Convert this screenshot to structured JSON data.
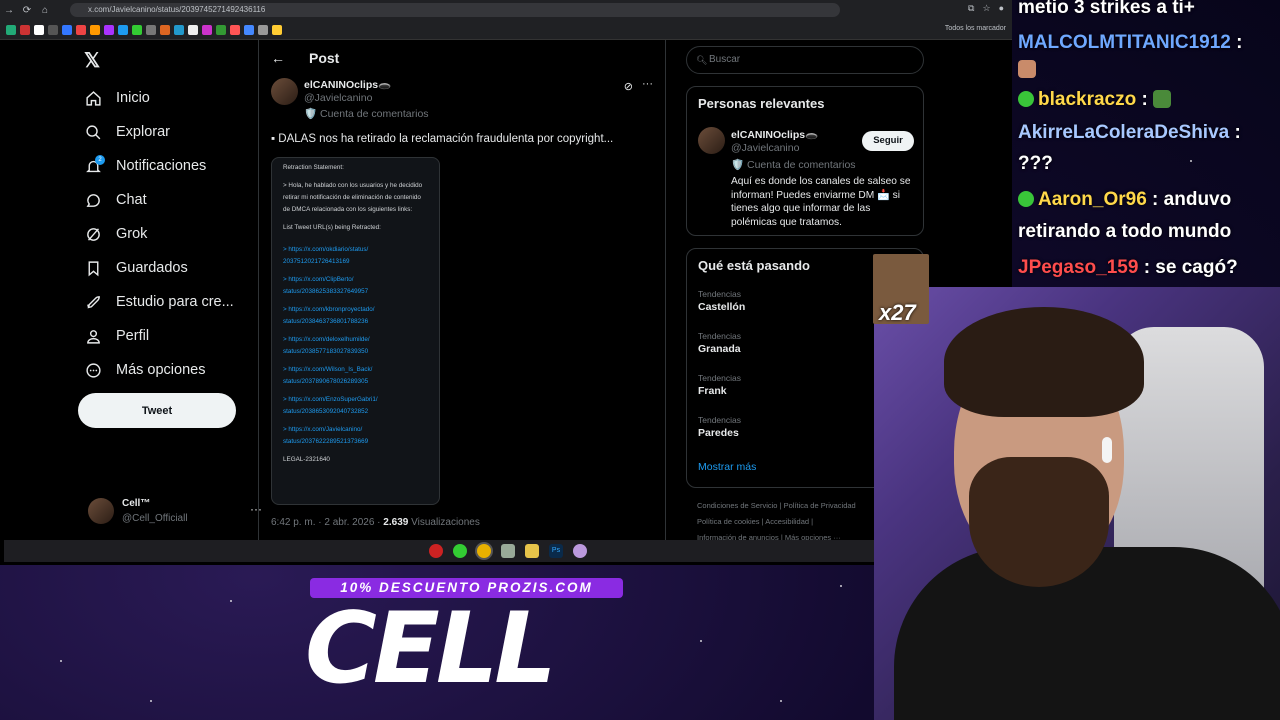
{
  "browser": {
    "url": "x.com/Javielcanino/status/2039745271492436116",
    "bookmark_folder": "Todos los marcador"
  },
  "nav": {
    "items": [
      {
        "label": "Inicio",
        "icon": "home-icon"
      },
      {
        "label": "Explorar",
        "icon": "search-icon"
      },
      {
        "label": "Notificaciones",
        "icon": "bell-icon"
      },
      {
        "label": "Chat",
        "icon": "chat-icon"
      },
      {
        "label": "Grok",
        "icon": "grok-icon"
      },
      {
        "label": "Guardados",
        "icon": "bookmark-icon"
      },
      {
        "label": "Estudio para cre...",
        "icon": "rocket-icon"
      },
      {
        "label": "Perfil",
        "icon": "person-icon"
      },
      {
        "label": "Más opciones",
        "icon": "more-circle-icon"
      }
    ],
    "notif_badge": "2",
    "tweet_button": "Tweet",
    "account": {
      "name": "Cell™",
      "handle": "@Cell_Officiall"
    }
  },
  "post": {
    "header": "Post",
    "author_name": "elCANINOclips🕳️",
    "author_handle": "@Javielcanino",
    "author_tag": "🛡️ Cuenta de comentarios",
    "text": "▪ DALAS nos ha retirado la reclamación fraudulenta por copyright...",
    "statement": {
      "title": "Retraction Statement:",
      "body": "> Hola, he hablado con los usuarios y he decidido retirar mi notificación de eliminación de contenido de DMCA relacionada con los siguientes links:",
      "list_title": "List Tweet URL(s) being Retracted:",
      "links": [
        "> https://x.com/okdiario/status/ 2037512021726413169",
        "> https://x.com/ClipBerto/ status/2038625383327649957",
        "> https://x.com/kbronproyectado/ status/2038463736801788236",
        "> https://x.com/deloxelhumilde/ status/2038577183027839350",
        "> https://x.com/Wilson_Is_Back/ status/2037890678026289305",
        "> https://x.com/EnzoSuperGabri1/ status/2038653092040732852",
        "> https://x.com/Javielcanino/ status/2037622289521373669"
      ],
      "legal": "LEGAL-2321640"
    },
    "time": "6:42 p. m. · 2 abr. 2026 · ",
    "views_count": "2.639",
    "views_label": " Visualizaciones"
  },
  "right": {
    "search_placeholder": "Buscar",
    "relevant_title": "Personas relevantes",
    "relevant_name": "elCANINOclips🕳️",
    "relevant_handle": "@Javielcanino",
    "relevant_tag": "🛡️ Cuenta de comentarios",
    "relevant_bio": "Aquí es donde los canales de salseo se informan! Puedes enviarme DM 📩 si tienes algo que informar de las polémicas que tratamos.",
    "follow_label": "Seguir",
    "trends_title": "Qué está pasando",
    "trends": [
      {
        "category": "Tendencias",
        "topic": "Castellón"
      },
      {
        "category": "Tendencias",
        "topic": "Granada"
      },
      {
        "category": "Tendencias",
        "topic": "Frank"
      },
      {
        "category": "Tendencias",
        "topic": "Paredes"
      }
    ],
    "show_more": "Mostrar más",
    "footer": [
      "Condiciones de Servicio",
      "|",
      "Política de Privacidad",
      "Política de cookies",
      "|",
      "Accesibilidad",
      "|",
      "Información de anuncios",
      "|",
      "Más opciones ···"
    ]
  },
  "chat": {
    "lines": [
      {
        "user": "",
        "msg": "metio 3 strikes a ti+",
        "color": "#ffffff"
      },
      {
        "user": "MALCOLMTITANIC1912",
        "msg": " :",
        "color": "#6fa8ff"
      },
      {
        "user": "",
        "msg": "",
        "color": "#ffffff",
        "emote": true
      },
      {
        "user": "blackraczo",
        "msg": " :",
        "color": "#ffd84a",
        "dot": true,
        "emote": true
      },
      {
        "user": "AkirreLaColeraDeShiva",
        "msg": " :",
        "color": "#a8c8ff"
      },
      {
        "user": "",
        "msg": "???",
        "color": "#ffffff"
      },
      {
        "user": "Aaron_Or96",
        "msg": " : anduvo",
        "color": "#ffd84a",
        "dot": true
      },
      {
        "user": "",
        "msg": "retirando a todo mundo",
        "color": "#ffffff"
      },
      {
        "user": "JPegaso_159",
        "msg": " : se cagó?",
        "color": "#ff4d4d"
      }
    ]
  },
  "overlay": {
    "popup_count": "x27",
    "promo": "10% DESCUENTO PROZIS.COM",
    "brand": "CELL"
  }
}
